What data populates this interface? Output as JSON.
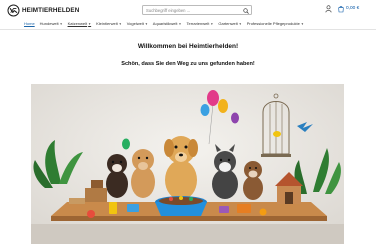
{
  "header": {
    "logo_text": "HEIMTIERHELDEN",
    "search_placeholder": "Suchbegriff eingeben ...",
    "cart_total": "0,00 €"
  },
  "nav": {
    "items": [
      {
        "label": "Home",
        "has_dropdown": false
      },
      {
        "label": "Hundewelt",
        "has_dropdown": true
      },
      {
        "label": "Katzenwelt",
        "has_dropdown": true
      },
      {
        "label": "Kleintierwelt",
        "has_dropdown": true
      },
      {
        "label": "Vogelwelt",
        "has_dropdown": true
      },
      {
        "label": "Aquaristikwelt",
        "has_dropdown": true
      },
      {
        "label": "Terrarienwelt",
        "has_dropdown": true
      },
      {
        "label": "Gartenwelt",
        "has_dropdown": true
      },
      {
        "label": "Professionelle Pflegeprodukte",
        "has_dropdown": true
      }
    ]
  },
  "main": {
    "title": "Willkommen bei Heimtierhelden!",
    "subtitle": "Schön, dass Sie den Weg zu uns gefunden haben!"
  },
  "colors": {
    "accent": "#1b64a8",
    "cart_text": "#0b5aa8"
  },
  "icons": [
    "logo-mark-icon",
    "search-icon",
    "user-icon",
    "cart-icon",
    "chevron-down-icon"
  ]
}
